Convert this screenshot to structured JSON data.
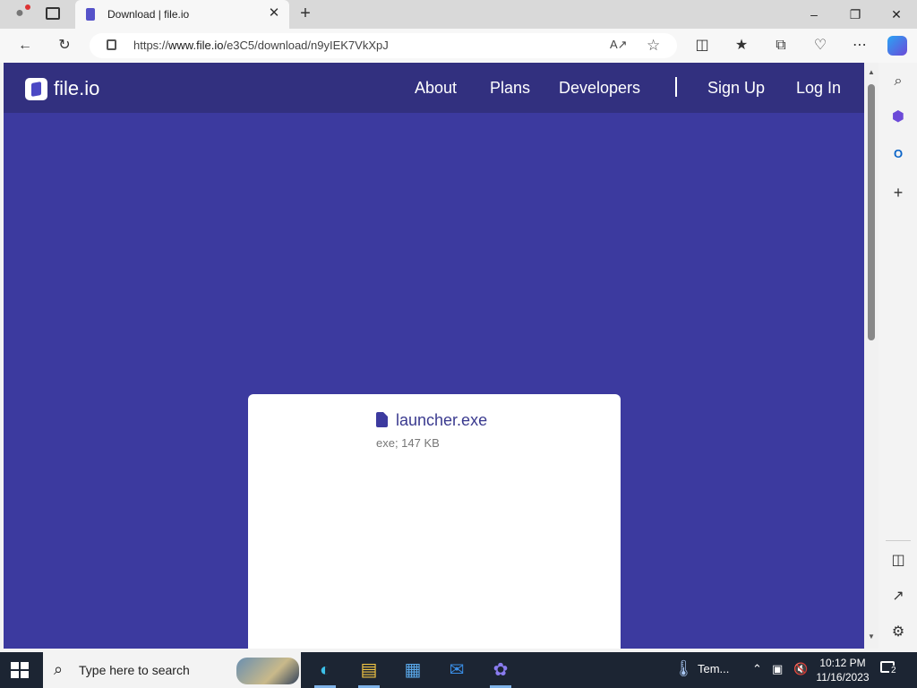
{
  "browser": {
    "tab_title": "Download | file.io",
    "url_prefix": "https://",
    "url_host": "www.file.io",
    "url_path": "/e3C5/download/n9yIEK7VkXpJ"
  },
  "site": {
    "logo_text": "file.io",
    "nav": {
      "about": "About",
      "plans": "Plans",
      "developers": "Developers",
      "sign_up": "Sign Up",
      "log_in": "Log In"
    }
  },
  "file": {
    "name": "launcher.exe",
    "meta": "exe; 147 KB"
  },
  "taskbar": {
    "search_placeholder": "Type here to search",
    "weather": "Tem...",
    "time": "10:12 PM",
    "date": "11/16/2023",
    "notifications": "2"
  },
  "colors": {
    "page_bg": "#3c3a9f",
    "header_bg": "#32307f",
    "card_bg": "#ffffff",
    "taskbar_bg": "#1c2533"
  }
}
